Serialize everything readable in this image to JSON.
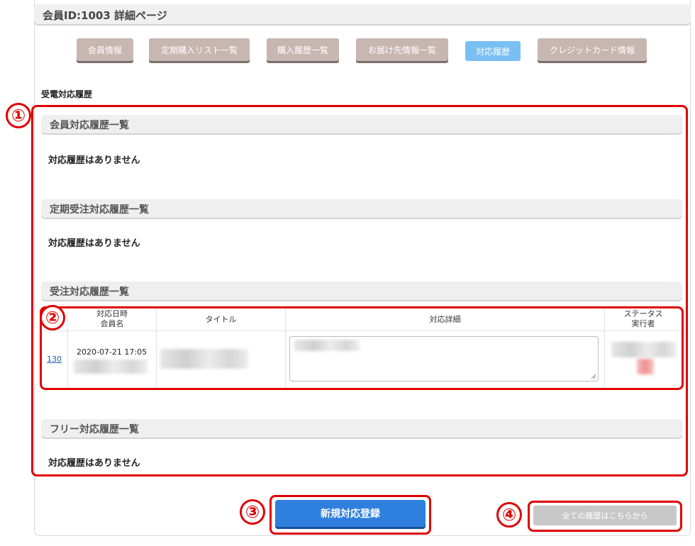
{
  "header": {
    "title": "会員ID:1003 詳細ページ"
  },
  "tabs": [
    {
      "label": "会員情報",
      "active": false
    },
    {
      "label": "定期購入リスト一覧",
      "active": false
    },
    {
      "label": "購入履歴一覧",
      "active": false
    },
    {
      "label": "お届け先情報一覧",
      "active": false
    },
    {
      "label": "対応履歴",
      "active": true
    },
    {
      "label": "クレジットカード情報",
      "active": false
    }
  ],
  "section": {
    "title": "受電対応履歴"
  },
  "lists": {
    "member": {
      "title": "会員対応履歴一覧",
      "empty": "対応履歴はありません"
    },
    "subscription": {
      "title": "定期受注対応履歴一覧",
      "empty": "対応履歴はありません"
    },
    "order": {
      "title": "受注対応履歴一覧",
      "columns": {
        "datetime_line1": "対応日時",
        "datetime_line2": "会員名",
        "title": "タイトル",
        "detail": "対応詳細",
        "status_line1": "ステータス",
        "status_line2": "実行者"
      },
      "rows": [
        {
          "id": "130",
          "datetime": "2020-07-21 17:05"
        }
      ]
    },
    "free": {
      "title": "フリー対応履歴一覧",
      "empty": "対応履歴はありません"
    }
  },
  "buttons": {
    "new_entry": "新規対応登録",
    "all_history": "全ての履歴はこちらから"
  },
  "markers": [
    "①",
    "②",
    "③",
    "④"
  ],
  "colors": {
    "highlight": "#e00000",
    "primary": "#2f7fdf",
    "active_tab": "#79bff4",
    "tab": "#c8b6b0"
  }
}
